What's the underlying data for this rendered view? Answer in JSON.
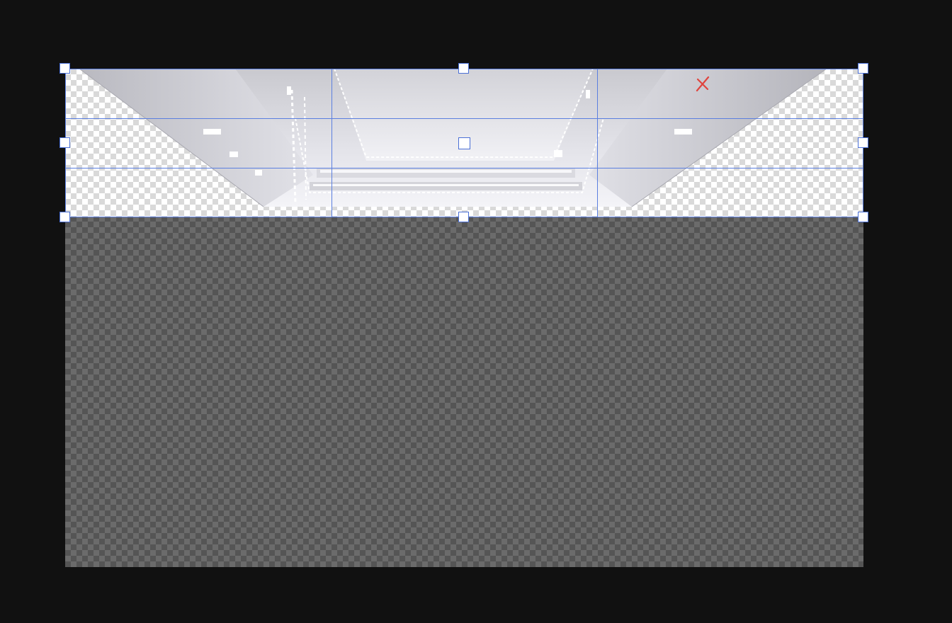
{
  "editor": {
    "mode": "crop",
    "grid": "rule-of-thirds"
  },
  "colors": {
    "workspace_bg": "#111111",
    "crop_outline": "#5b7fe0",
    "handle_fill": "#ffffff",
    "pin_mark": "#e0443e"
  },
  "icons": {
    "pin_mark": "red-x-mark-icon"
  }
}
